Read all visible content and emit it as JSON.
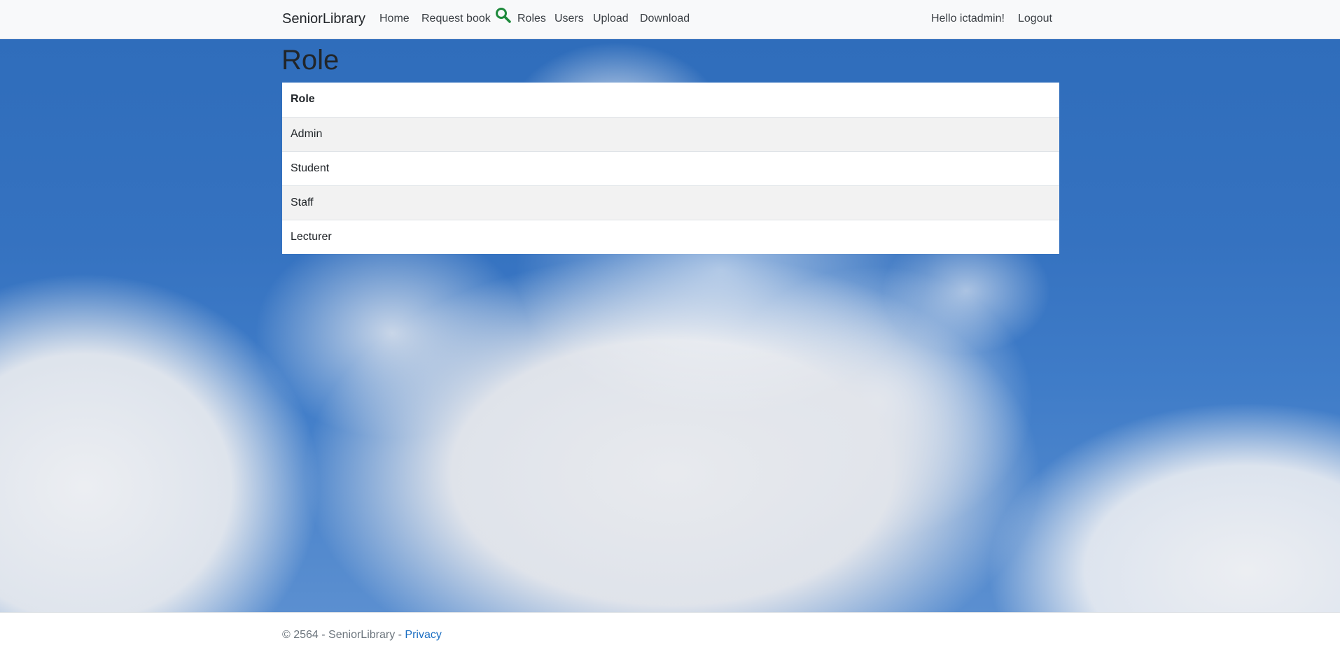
{
  "navbar": {
    "brand": "SeniorLibrary",
    "links": [
      {
        "label": "Home"
      },
      {
        "label": "Request book"
      },
      {
        "label": "Roles"
      },
      {
        "label": "Users"
      },
      {
        "label": "Upload"
      },
      {
        "label": "Download"
      }
    ],
    "search_icon": "search-icon",
    "search_icon_color": "#1e8a3c",
    "greeting": "Hello ictadmin!",
    "logout": "Logout"
  },
  "page": {
    "title": "Role"
  },
  "table": {
    "header": "Role",
    "rows": [
      "Admin",
      "Student",
      "Staff",
      "Lecturer"
    ]
  },
  "footer": {
    "text": "© 2564 - SeniorLibrary - ",
    "privacy": "Privacy",
    "link_color": "#1b6ec2"
  }
}
